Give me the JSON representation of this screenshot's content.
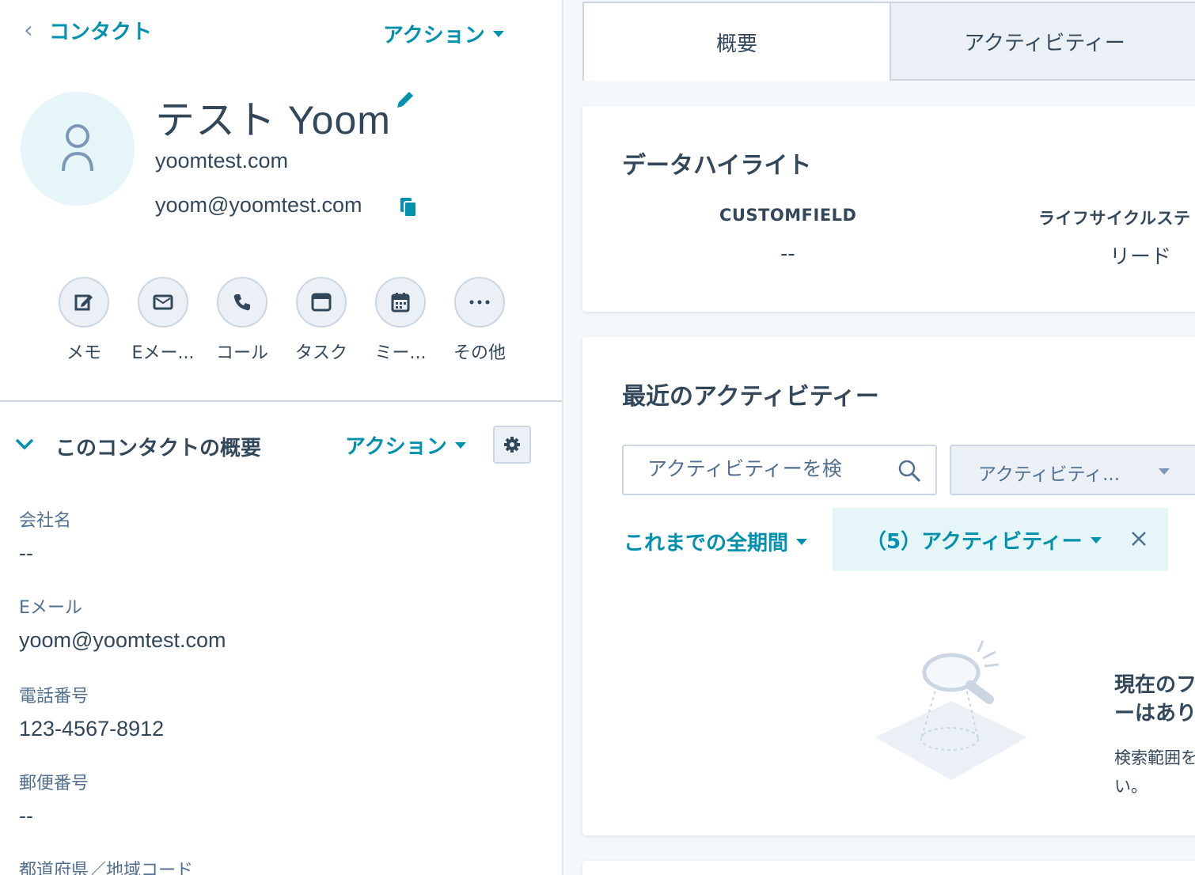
{
  "header": {
    "back_label": "コンタクト",
    "action_label": "アクション"
  },
  "contact": {
    "name": "テスト Yoom",
    "domain": "yoomtest.com",
    "email": "yoom@yoomtest.com"
  },
  "quick_actions": [
    {
      "label": "メモ",
      "icon": "edit-note-icon"
    },
    {
      "label": "Eメー...",
      "icon": "email-icon"
    },
    {
      "label": "コール",
      "icon": "phone-icon"
    },
    {
      "label": "タスク",
      "icon": "task-icon"
    },
    {
      "label": "ミー...",
      "icon": "calendar-icon"
    },
    {
      "label": "その他",
      "icon": "more-icon"
    }
  ],
  "summary": {
    "title": "このコンタクトの概要",
    "action_label": "アクション",
    "properties": [
      {
        "label": "会社名",
        "value": "--"
      },
      {
        "label": "Eメール",
        "value": "yoom@yoomtest.com"
      },
      {
        "label": "電話番号",
        "value": "123-4567-8912"
      },
      {
        "label": "郵便番号",
        "value": "--"
      },
      {
        "label": "都道府県／地域コード",
        "value": ""
      }
    ]
  },
  "tabs": [
    {
      "label": "概要",
      "active": true
    },
    {
      "label": "アクティビティー",
      "active": false
    }
  ],
  "highlights": {
    "title": "データハイライト",
    "items": [
      {
        "label": "CUSTOMFIELD",
        "value": "--"
      },
      {
        "label": "ライフサイクルステ",
        "value": "リード"
      }
    ]
  },
  "recent_activity": {
    "title": "最近のアクティビティー",
    "search_placeholder": "アクティビティーを検",
    "filter_label": "アクティビティ...",
    "period_label": "これまでの全期間",
    "chip_label": "（5）アクティビティー",
    "empty_title_line1": "現在のフ",
    "empty_title_line2": "ーはあり",
    "empty_desc_line1": "検索範囲を",
    "empty_desc_line2": "い。"
  },
  "colors": {
    "accent": "#0091ae",
    "text": "#33475b",
    "border": "#cbd6e2",
    "panel_bg": "#f5f8fa"
  }
}
